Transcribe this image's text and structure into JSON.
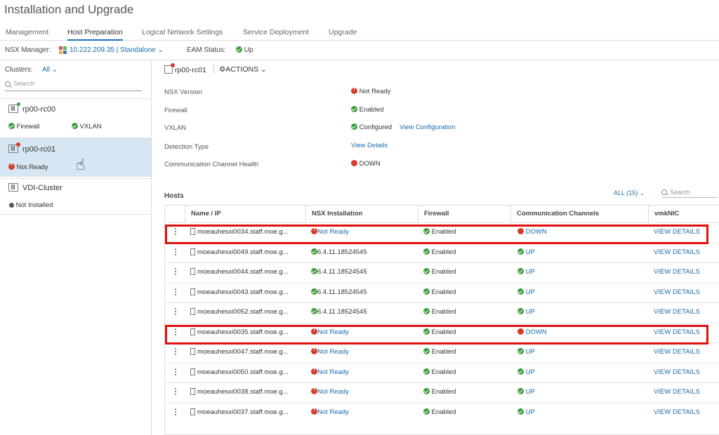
{
  "page": {
    "title": "Installation and Upgrade"
  },
  "tabs": [
    {
      "label": "Management"
    },
    {
      "label": "Host Preparation"
    },
    {
      "label": "Logical Network Settings"
    },
    {
      "label": "Service Deployment"
    },
    {
      "label": "Upgrade"
    }
  ],
  "manager_bar": {
    "manager_label": "NSX Manager:",
    "manager_value": "10.222.209.35 | Standalone",
    "eam_label": "EAM Status:",
    "eam_value": "Up"
  },
  "sidebar": {
    "clusters_label": "Clusters:",
    "clusters_value": "All",
    "search_placeholder": "Search",
    "clusters": [
      {
        "name": "rp00-rc00",
        "status1": "Firewall",
        "status2": "VXLAN"
      },
      {
        "name": "rp00-rc01",
        "status1": "Not Ready"
      },
      {
        "name": "VDI-Cluster",
        "status1": "Not Installed"
      }
    ]
  },
  "main": {
    "cluster_name": "rp00-rc01",
    "actions_label": "ACTIONS",
    "props": [
      {
        "label": "NSX Version",
        "value": "Not Ready"
      },
      {
        "label": "Firewall",
        "value": "Enabled"
      },
      {
        "label": "VXLAN",
        "value": "Configured",
        "link": "View Configuration"
      },
      {
        "label": "Detection Type",
        "link": "View Details"
      },
      {
        "label": "Communication Channel Health",
        "value": "DOWN"
      }
    ],
    "hosts_label": "Hosts",
    "all_filter": "ALL (15)",
    "search_placeholder": "Search"
  },
  "table": {
    "headers": [
      "Name / IP",
      "NSX Installation",
      "Firewall",
      "Communication Channels",
      "vmkNIC"
    ],
    "rows": [
      {
        "name": "moeauhesxi0034.staff.moe.g...",
        "install": "Not Ready",
        "firewall": "Enabled",
        "comm": "DOWN",
        "vmk": "VIEW DETAILS"
      },
      {
        "name": "moeauhesxi0049.staff.moe.g...",
        "install": "6.4.11.18524545",
        "firewall": "Enabled",
        "comm": "UP",
        "vmk": "VIEW DETAILS"
      },
      {
        "name": "moeauhesxi0044.staff.moe.g...",
        "install": "6.4.11.18524545",
        "firewall": "Enabled",
        "comm": "UP",
        "vmk": "VIEW DETAILS"
      },
      {
        "name": "moeauhesxi0043.staff.moe.g...",
        "install": "6.4.11.18524545",
        "firewall": "Enabled",
        "comm": "UP",
        "vmk": "VIEW DETAILS"
      },
      {
        "name": "moeauhesxi0052.staff.moe.g...",
        "install": "6.4.11.18524545",
        "firewall": "Enabled",
        "comm": "UP",
        "vmk": "VIEW DETAILS"
      },
      {
        "name": "moeauhesxi0035.staff.moe.g...",
        "install": "Not Ready",
        "firewall": "Enabled",
        "comm": "DOWN",
        "vmk": "VIEW DETAILS"
      },
      {
        "name": "moeauhesxi0047.staff.moe.g...",
        "install": "Not Ready",
        "firewall": "Enabled",
        "comm": "UP",
        "vmk": "VIEW DETAILS"
      },
      {
        "name": "moeauhesxi0050.staff.moe.g...",
        "install": "Not Ready",
        "firewall": "Enabled",
        "comm": "UP",
        "vmk": "VIEW DETAILS"
      },
      {
        "name": "moeauhesxi0038.staff.moe.g...",
        "install": "Not Ready",
        "firewall": "Enabled",
        "comm": "UP",
        "vmk": "VIEW DETAILS"
      },
      {
        "name": "moeauhesxi0037.staff.moe.g...",
        "install": "Not Ready",
        "firewall": "Enabled",
        "comm": "UP",
        "vmk": "VIEW DETAILS"
      }
    ]
  },
  "colors": {
    "accent": "#1a73c0",
    "ok": "#3b9b3b",
    "error": "#d43b2a",
    "highlight": "#e01010"
  }
}
